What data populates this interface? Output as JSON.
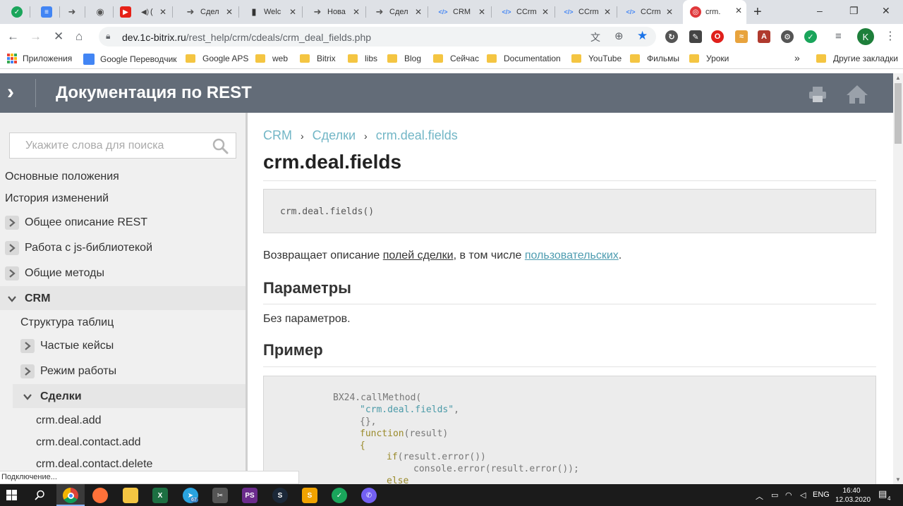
{
  "browser": {
    "tabs": [
      {
        "title": "",
        "icon": "bitrix24-icon",
        "color": "#1aa55b"
      },
      {
        "title": "",
        "icon": "docs-icon",
        "color": "#4285f4"
      },
      {
        "title": "",
        "icon": "arrow-circle-icon",
        "color": "#555555"
      },
      {
        "title": "",
        "icon": "globe-icon",
        "color": "#555555"
      },
      {
        "title": "(",
        "icon": "youtube-icon",
        "color": "#e62117"
      },
      {
        "title": "Сдел",
        "icon": "arrow-circle-icon",
        "color": "#555555"
      },
      {
        "title": "Welc",
        "icon": "book-icon",
        "color": "#333333"
      },
      {
        "title": "Нова",
        "icon": "arrow-circle-icon",
        "color": "#555555"
      },
      {
        "title": "Сдел",
        "icon": "arrow-circle-icon",
        "color": "#555555"
      },
      {
        "title": "CRM",
        "icon": "code-icon",
        "color": "#4285f4"
      },
      {
        "title": "CCrm",
        "icon": "code-icon",
        "color": "#4285f4"
      },
      {
        "title": "CCrm",
        "icon": "code-icon",
        "color": "#4285f4"
      },
      {
        "title": "CCrm",
        "icon": "code-icon",
        "color": "#4285f4"
      },
      {
        "title": "crm.",
        "icon": "bitrix-target-icon",
        "color": "#e0383b",
        "active": true
      }
    ],
    "new_tab": "+",
    "window_controls": {
      "minimize": "–",
      "restore": "❐",
      "close": "✕"
    },
    "url_host": "dev.1c-bitrix.ru",
    "url_path": "/rest_help/crm/cdeals/crm_deal_fields.php",
    "profile_initial": "K",
    "bookmarks": [
      {
        "label": "Приложения",
        "icon": "apps-icon"
      },
      {
        "label": "Google Переводчик",
        "icon": "translate-icon"
      },
      {
        "label": "Google APS",
        "icon": "folder-icon"
      },
      {
        "label": "web",
        "icon": "folder-icon"
      },
      {
        "label": "Bitrix",
        "icon": "folder-icon"
      },
      {
        "label": "libs",
        "icon": "folder-icon"
      },
      {
        "label": "Blog",
        "icon": "folder-icon"
      },
      {
        "label": "Сейчас",
        "icon": "folder-icon"
      },
      {
        "label": "Documentation",
        "icon": "folder-icon"
      },
      {
        "label": "YouTube",
        "icon": "folder-icon"
      },
      {
        "label": "Фильмы",
        "icon": "folder-icon"
      },
      {
        "label": "Уроки",
        "icon": "folder-icon"
      }
    ],
    "bookmarks_overflow": "»",
    "other_bookmarks": "Другие закладки"
  },
  "header": {
    "title": "Документация по REST"
  },
  "sidebar": {
    "search_placeholder": "Укажите слова для поиска",
    "items": [
      {
        "label": "Основные положения",
        "level": 0
      },
      {
        "label": "История изменений",
        "level": 0
      },
      {
        "label": "Общее описание REST",
        "level": 0,
        "toggle": "collapsed"
      },
      {
        "label": "Работа с js-библиотекой",
        "level": 0,
        "toggle": "collapsed"
      },
      {
        "label": "Общие методы",
        "level": 0,
        "toggle": "collapsed"
      },
      {
        "label": "CRM",
        "level": 0,
        "toggle": "expanded",
        "bold": true
      },
      {
        "label": "Структура таблиц",
        "level": 1
      },
      {
        "label": "Частые кейсы",
        "level": 1,
        "toggle": "collapsed"
      },
      {
        "label": "Режим работы",
        "level": 1,
        "toggle": "collapsed"
      },
      {
        "label": "Сделки",
        "level": 1,
        "toggle": "expanded",
        "bold": true
      },
      {
        "label": "crm.deal.add",
        "level": 2
      },
      {
        "label": "crm.deal.contact.add",
        "level": 2
      },
      {
        "label": "crm.deal.contact.delete",
        "level": 2
      }
    ]
  },
  "content": {
    "breadcrumb": [
      "CRM",
      "Сделки",
      "crm.deal.fields"
    ],
    "breadcrumb_sep": "›",
    "title": "crm.deal.fields",
    "signature": "crm.deal.fields()",
    "desc_prefix": "Возвращает описание ",
    "desc_link1": "полей сделки",
    "desc_middle": ", в том числе ",
    "desc_link2": "пользовательских",
    "desc_suffix": ".",
    "params_heading": "Параметры",
    "params_text": "Без параметров.",
    "example_heading": "Пример",
    "code": {
      "l1": "BX24.callMethod(",
      "l2": "\"crm.deal.fields\"",
      "l2b": ",",
      "l3": "{},",
      "l4": "function",
      "l4b": "(result)",
      "l5": "{",
      "l6": "if",
      "l6b": "(result.error())",
      "l7": "console.error(result.error());",
      "l8": "else"
    }
  },
  "status_text": "Подключение...",
  "taskbar": {
    "lang": "ENG",
    "time": "16:40",
    "date": "12.03.2020",
    "notifications": "4",
    "telegram_badge": "67"
  }
}
